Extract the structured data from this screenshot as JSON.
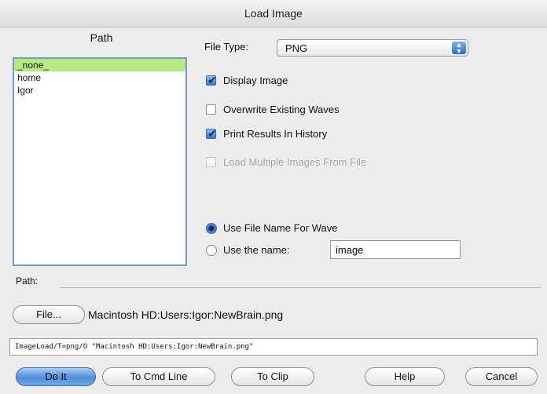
{
  "window": {
    "title": "Load Image"
  },
  "path_panel": {
    "header": "Path",
    "items": [
      "_none_",
      "home",
      "Igor"
    ],
    "selected_index": 0
  },
  "file_type": {
    "label": "File Type:",
    "value": "PNG"
  },
  "options": {
    "display_image": {
      "label": "Display Image",
      "checked": true
    },
    "overwrite_waves": {
      "label": "Overwrite Existing Waves",
      "checked": false
    },
    "print_history": {
      "label": "Print Results In History",
      "checked": true
    },
    "load_multiple": {
      "label": "Load Multiple Images From File",
      "checked": false,
      "enabled": false
    }
  },
  "wave_naming": {
    "use_file_name_label": "Use File Name For Wave",
    "use_name_label": "Use the name:",
    "name_value": "image",
    "selected": "use_file_name"
  },
  "path_bar": {
    "label": "Path:"
  },
  "file_button": {
    "label": "File...",
    "path_value": "Macintosh HD:Users:Igor:NewBrain.png"
  },
  "command_line": "ImageLoad/T=png/O \"Macintosh HD:Users:Igor:NewBrain.png\"",
  "buttons": {
    "do_it": "Do It",
    "to_cmd_line": "To Cmd Line",
    "to_clip": "To Clip",
    "help": "Help",
    "cancel": "Cancel"
  },
  "colors": {
    "selected_row": "#b7ea80",
    "accent": "#3577cf"
  }
}
